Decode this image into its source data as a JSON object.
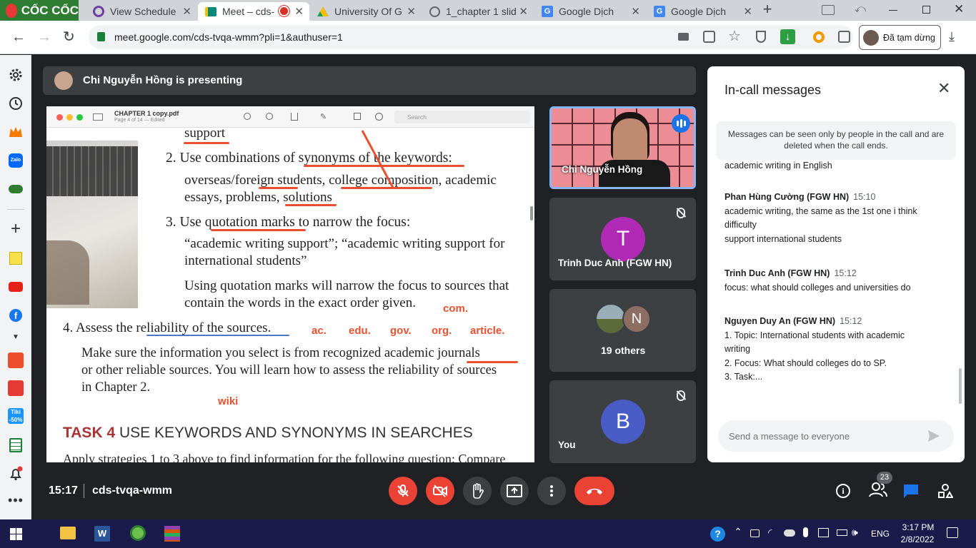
{
  "browser": {
    "brand": "CỐC CỐC",
    "tabs": [
      {
        "title": "View Schedule",
        "active": false
      },
      {
        "title": "Meet – cds-",
        "active": true
      },
      {
        "title": "University Of G",
        "active": false
      },
      {
        "title": "1_chapter 1 slid",
        "active": false
      },
      {
        "title": "Google Dịch",
        "active": false
      },
      {
        "title": "Google Dịch",
        "active": false
      }
    ],
    "url": "meet.google.com/cds-tvqa-wmm?pli=1&authuser=1",
    "profile_label": "Đã tạm dừng"
  },
  "meet": {
    "presenting_banner": "Chi Nguyễn Hồng is presenting",
    "time": "15:17",
    "meeting_code": "cds-tvqa-wmm",
    "people_count": "23",
    "tiles": [
      {
        "name": "Chi Nguyễn Hồng",
        "type": "video"
      },
      {
        "name": "Trinh Duc Anh (FGW HN)",
        "initial": "T",
        "color": "#b02ab6"
      },
      {
        "name": "19 others",
        "initial": "N",
        "color": "#8d6e63"
      },
      {
        "name": "You",
        "initial": "B",
        "color": "#4a5cc6"
      }
    ]
  },
  "pdf": {
    "filename": "CHAPTER 1 copy.pdf",
    "page_info": "Page 4 of 14 — Edited",
    "search_placeholder": "Search",
    "lines": {
      "l0": "support",
      "l1": "2.  Use combinations of synonyms of the keywords:",
      "l2": "overseas/foreign students, college composition, academic",
      "l3": "essays, problems, solutions",
      "l4": "3.  Use quotation marks to narrow the focus:",
      "l5": "“academic writing support”; “academic writing support for",
      "l6": "international students”",
      "l7": "Using quotation marks will narrow the focus to sources that",
      "l8": "contain the words in the exact order given.",
      "l9": "4.  Assess the reliability of the sources.",
      "l10": "Make sure the information you select is from recognized academic journals",
      "l11": "or other reliable sources. You will learn how to assess the reliability of sources",
      "l12": "in Chapter 2.",
      "task_num": "TASK 4",
      "task_title": " USE KEYWORDS AND SYNONYMS IN SEARCHES",
      "l13": "Apply strategies 1 to 3 above to find information for the following question: Compare"
    },
    "annotations": {
      "com": "com.",
      "ac": "ac.",
      "edu": "edu.",
      "gov": "gov.",
      "org": "org.",
      "article": "article.",
      "wiki": "wiki"
    }
  },
  "chat": {
    "title": "In-call messages",
    "notice": "Messages can be seen only by people in the call and are deleted when the call ends.",
    "partial_text": "academic writing in English",
    "messages": [
      {
        "sender": "Phan Hùng Cường (FGW HN)",
        "time": "15:10",
        "lines": [
          "academic writing, the same as the 1st one i think",
          "difficulty",
          "support international students"
        ]
      },
      {
        "sender": "Trinh Duc Anh (FGW HN)",
        "time": "15:12",
        "lines": [
          "focus: what should colleges and universities do"
        ]
      },
      {
        "sender": "Nguyen Duy An (FGW HN)",
        "time": "15:12",
        "lines": [
          "1. Topic: International students with academic",
          "writing",
          "2. Focus: What should colleges do to SP.",
          "3. Task:..."
        ]
      }
    ],
    "input_placeholder": "Send a message to everyone"
  },
  "taskbar": {
    "lang": "ENG",
    "time": "3:17 PM",
    "date": "2/8/2022"
  },
  "colors": {
    "meet_bg": "#202124",
    "end_call": "#ea4335",
    "annotation": "#e8502f",
    "chat_accent": "#1a73e8"
  }
}
